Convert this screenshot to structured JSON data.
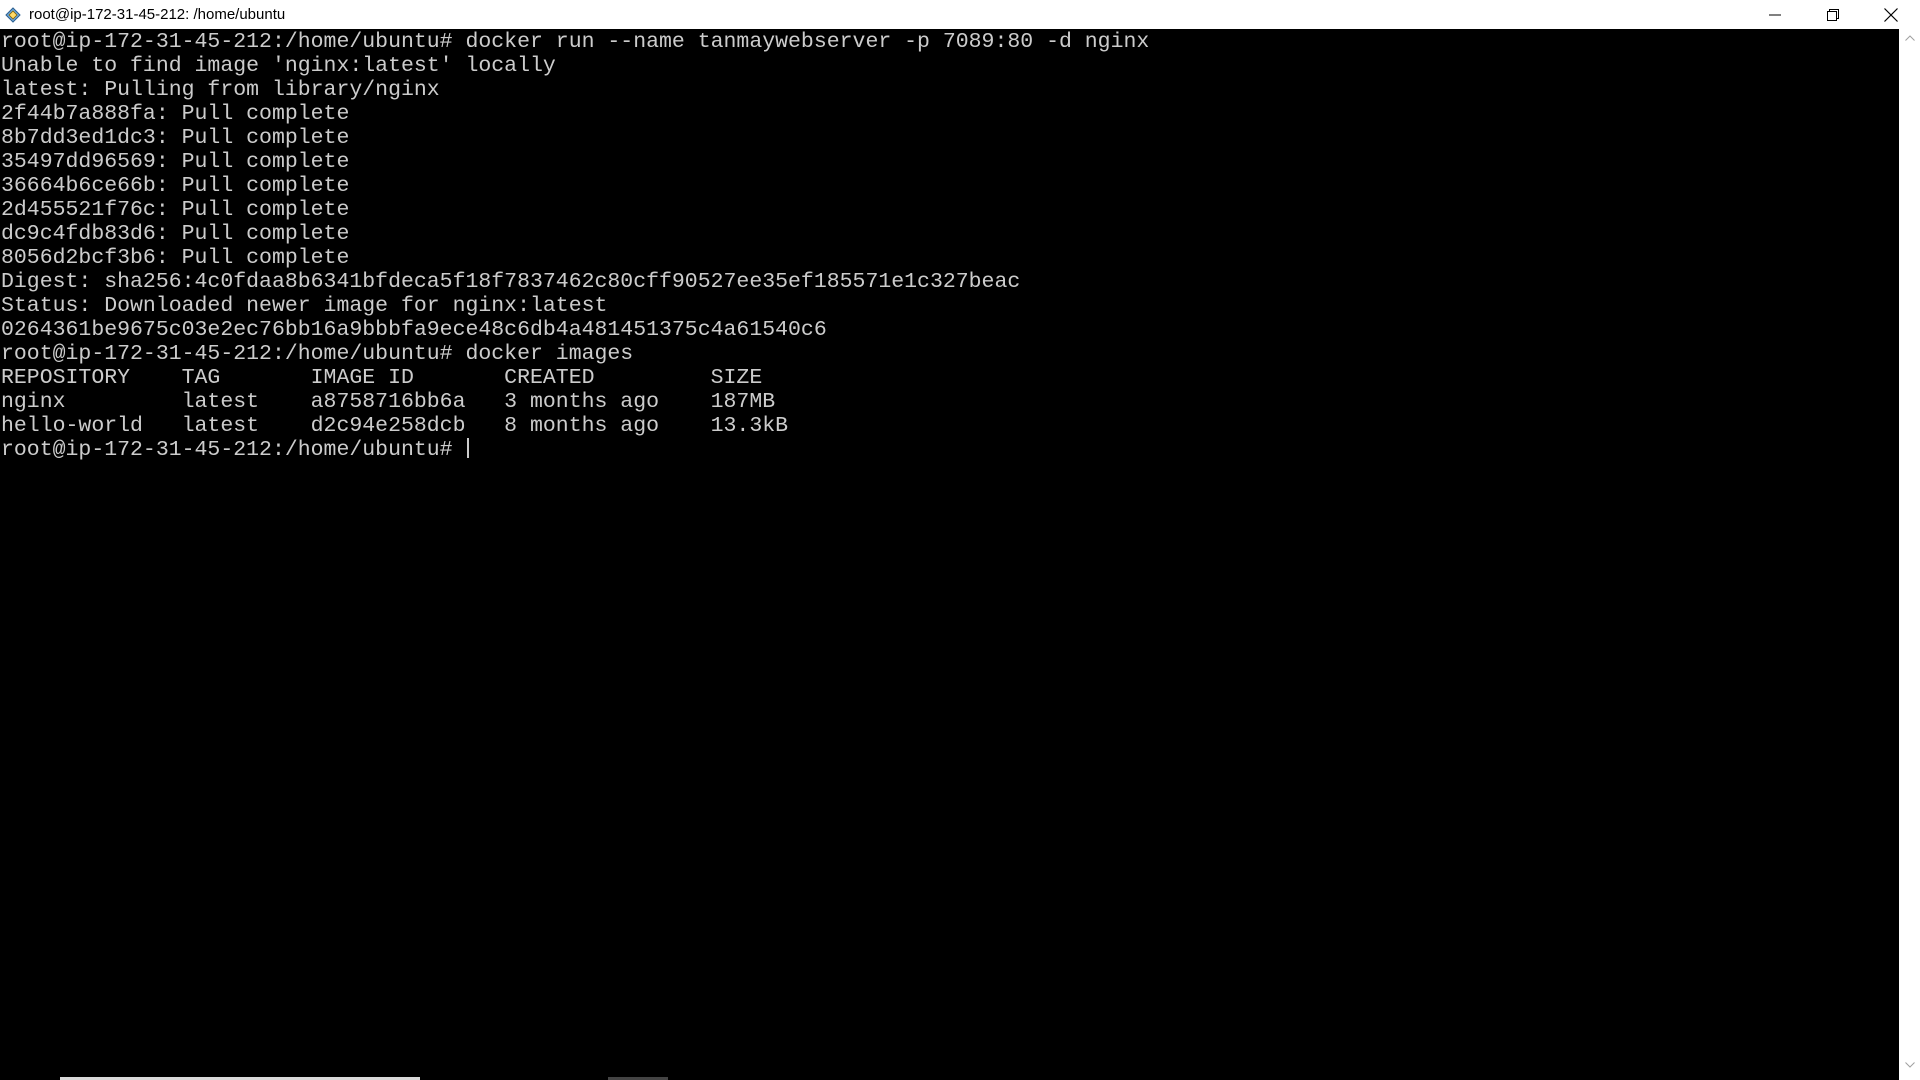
{
  "window": {
    "title": "root@ip-172-31-45-212: /home/ubuntu",
    "app_icon": "putty-icon",
    "controls": [
      "minimize-icon",
      "restore-icon",
      "close-icon"
    ]
  },
  "terminal": {
    "text_color": "#cccccc",
    "background": "#000000",
    "lines": [
      "root@ip-172-31-45-212:/home/ubuntu# docker run --name tanmaywebserver -p 7089:80 -d nginx",
      "Unable to find image 'nginx:latest' locally",
      "latest: Pulling from library/nginx",
      "2f44b7a888fa: Pull complete",
      "8b7dd3ed1dc3: Pull complete",
      "35497dd96569: Pull complete",
      "36664b6ce66b: Pull complete",
      "2d455521f76c: Pull complete",
      "dc9c4fdb83d6: Pull complete",
      "8056d2bcf3b6: Pull complete",
      "Digest: sha256:4c0fdaa8b6341bfdeca5f18f7837462c80cff90527ee35ef185571e1c327beac",
      "Status: Downloaded newer image for nginx:latest",
      "0264361be9675c03e2ec76bb16a9bbbfa9ece48c6db4a481451375c4a61540c6",
      "root@ip-172-31-45-212:/home/ubuntu# docker images",
      "REPOSITORY    TAG       IMAGE ID       CREATED         SIZE",
      "nginx         latest    a8758716bb6a   3 months ago    187MB",
      "hello-world   latest    d2c94e258dcb   8 months ago    13.3kB",
      "root@ip-172-31-45-212:/home/ubuntu# "
    ]
  }
}
